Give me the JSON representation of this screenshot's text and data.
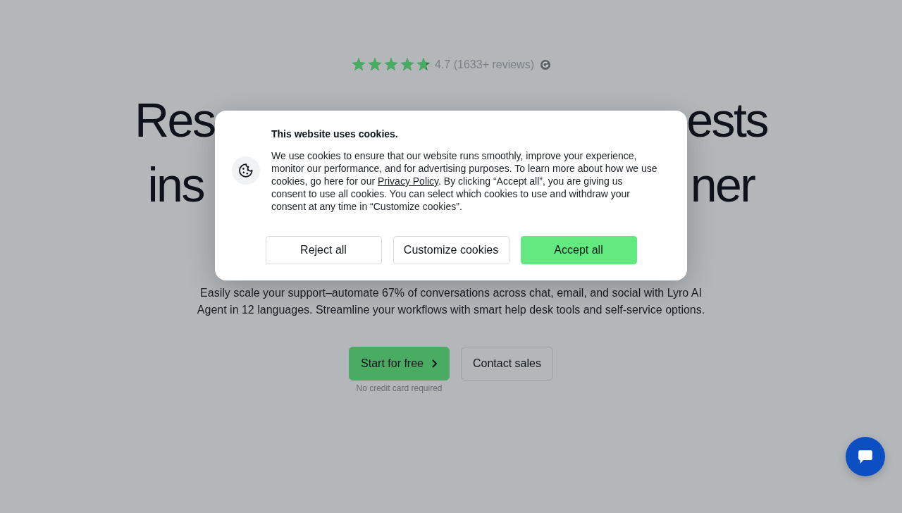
{
  "rating": {
    "stars": 4.7,
    "text": "4.7 (1633+ reviews)"
  },
  "headline": {
    "lines": [
      {
        "fragments": [
          "Res",
          "ests"
        ]
      },
      {
        "fragments": [
          "ins",
          "ner"
        ]
      }
    ]
  },
  "intro": {
    "text": "Easily scale your support–automate 67% of conversations across chat, email, and social with Lyro AI Agent in 12 languages. Streamline your workflows with smart help desk tools and self-service options.",
    "buttons": [
      {
        "label": "Start for free",
        "kind": "primary",
        "note": "No credit card required"
      },
      {
        "label": "Contact sales",
        "kind": "outline"
      }
    ]
  },
  "cookie_dialog": {
    "title": "This website uses cookies.",
    "body": [
      {
        "kind": "text",
        "text": "We use cookies to ensure that our website runs smoothly, improve your experience, monitor our performance, and for advertising purposes. To learn more about how we use cookies, go here for our "
      },
      {
        "kind": "link",
        "text": "Privacy Policy"
      },
      {
        "kind": "text",
        "text": ". By clicking “Accept all”, you are giving us consent to use all cookies. You can select which cookies to use and withdraw your consent at any time in “Customize cookies”."
      }
    ],
    "buttons": [
      {
        "label": "Reject all",
        "kind": "outline"
      },
      {
        "label": "Customize cookies",
        "kind": "outline"
      },
      {
        "label": "Accept all",
        "kind": "primary"
      }
    ]
  }
}
